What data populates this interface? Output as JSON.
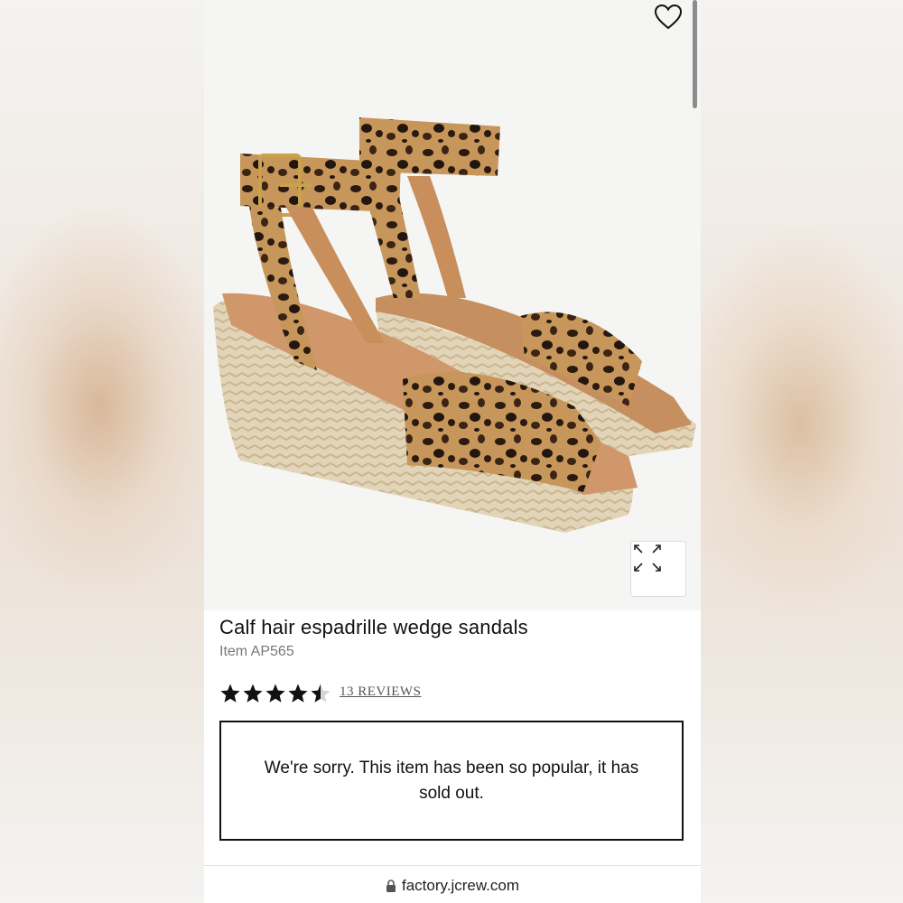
{
  "product": {
    "title": "Calf hair espadrille wedge sandals",
    "item_number": "Item AP565",
    "rating": 4.5,
    "rating_max": 5,
    "reviews_label": "13 REVIEWS",
    "soldout_message": "We're sorry. This item has been so popular, it has sold out."
  },
  "browser": {
    "url": "factory.jcrew.com"
  },
  "icons": {
    "favorite": "heart-icon",
    "expand": "expand-icon",
    "lock": "lock-icon",
    "star": "star-icon"
  },
  "colors": {
    "star": "#111111",
    "border": "#111111",
    "muted_text": "#777777"
  }
}
